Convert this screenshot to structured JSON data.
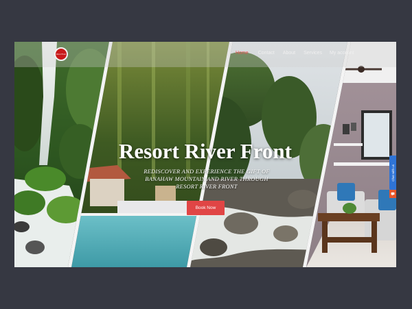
{
  "brand": {
    "logo_text": "River Front"
  },
  "nav": {
    "items": [
      {
        "label": "Home",
        "active": true
      },
      {
        "label": "Contact",
        "active": false
      },
      {
        "label": "About",
        "active": false
      },
      {
        "label": "Services",
        "active": false
      },
      {
        "label": "My account",
        "active": false
      }
    ]
  },
  "hero": {
    "title": "Resort River Front",
    "subtitle": "REDISCOVER AND EXPERIENCE THE GIFT OF BANAHAW MOUNTAIN AND RIVER THROUGH RESORT RIVER FRONT",
    "button_label": "Book Now"
  },
  "chat": {
    "tab_label": "Chat with us",
    "icon": "chat-bubble-icon"
  },
  "colors": {
    "page_bg": "#363842",
    "accent": "#e04545",
    "nav_active": "#e85656",
    "chat_tab": "#2f74d6",
    "chat_button": "#e8562b"
  }
}
